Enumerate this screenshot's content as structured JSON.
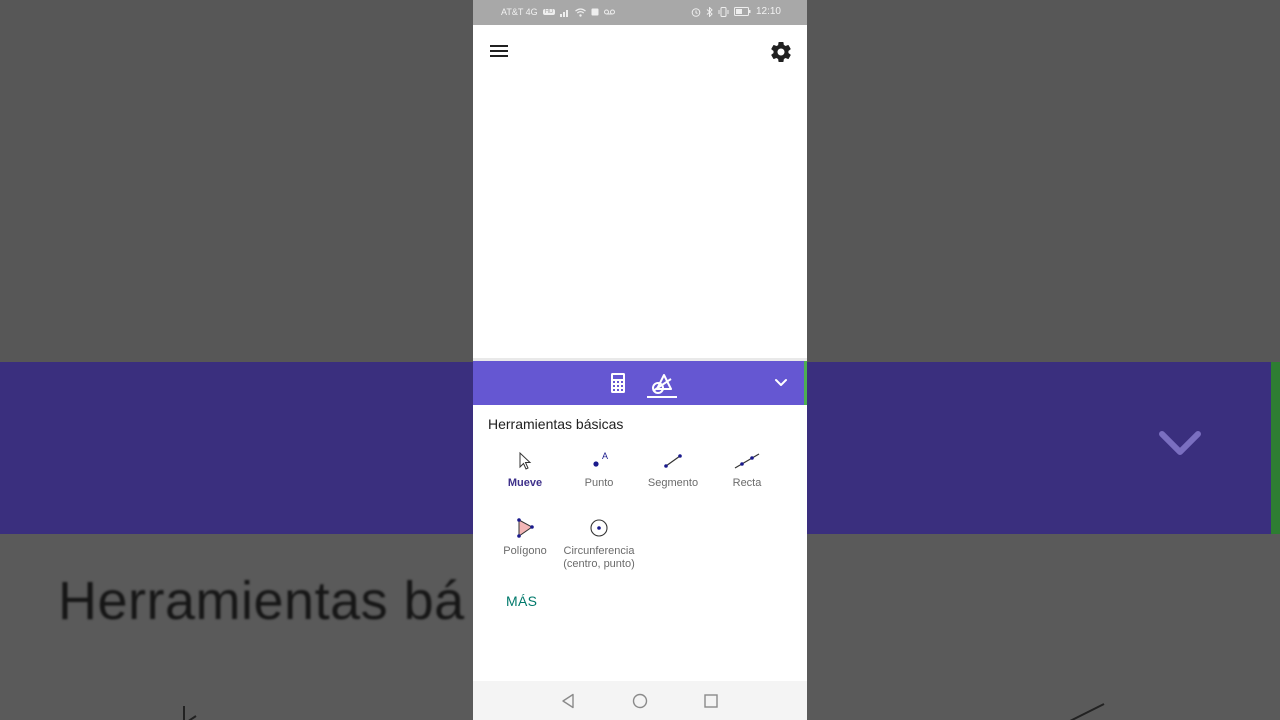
{
  "status_bar": {
    "carrier": "AT&T 4G",
    "network_badge": "HD",
    "time": "12:10",
    "icons": [
      "signal-icon",
      "wifi-icon",
      "stop-icon",
      "voicemail-icon",
      "alarm-icon",
      "bluetooth-icon",
      "vibrate-icon",
      "battery-icon"
    ]
  },
  "app_bar": {
    "menu_icon": "hamburger-menu-icon",
    "settings_icon": "gear-icon"
  },
  "toolbar": {
    "tabs": [
      {
        "name": "calculator",
        "icon": "calculator-icon",
        "selected": false
      },
      {
        "name": "tools",
        "icon": "geometry-tools-icon",
        "selected": true
      }
    ],
    "collapse_icon": "chevron-down-icon",
    "color": "#6557d2"
  },
  "tools_panel": {
    "title": "Herramientas básicas",
    "tools": [
      {
        "label": "Mueve",
        "icon": "move-cursor-icon",
        "active": true
      },
      {
        "label": "Punto",
        "icon": "point-icon",
        "point_letter": "A",
        "active": false
      },
      {
        "label": "Segmento",
        "icon": "segment-icon",
        "active": false
      },
      {
        "label": "Recta",
        "icon": "line-icon",
        "active": false
      },
      {
        "label": "Polígono",
        "icon": "polygon-icon",
        "active": false
      },
      {
        "label": "Circunferencia\n(centro, punto)",
        "label_line1": "Circunferencia",
        "label_line2": "(centro, punto)",
        "icon": "circle-center-point-icon",
        "active": false
      }
    ],
    "more_label": "MÁS",
    "more_color": "#00796b"
  },
  "background": {
    "blurred_text": "Herramientas bá"
  },
  "nav_bar": {
    "icons": [
      "back-icon",
      "home-icon",
      "recent-apps-icon"
    ]
  }
}
